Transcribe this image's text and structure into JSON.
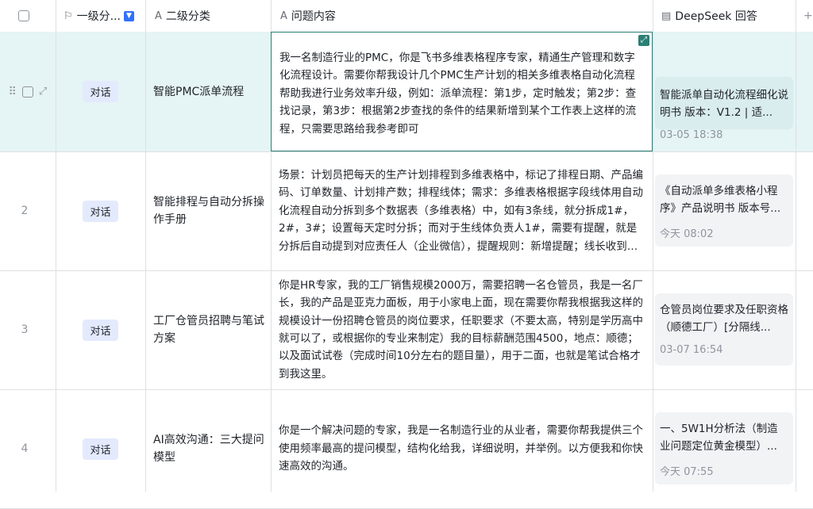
{
  "columns": {
    "level1": "一级分...",
    "level2": "二级分类",
    "question": "问题内容",
    "answer": "DeepSeek 回答"
  },
  "icons": {
    "level1": "flag-icon",
    "level2": "text-icon",
    "question": "text-icon",
    "answer": "document-icon",
    "filter": "filter-icon"
  },
  "rows": [
    {
      "index": "",
      "tag": "对话",
      "category": "智能PMC派单流程",
      "question": "我一名制造行业的PMC，你是飞书多维表格程序专家，精通生产管理和数字化流程设计。需要你帮我设计几个PMC生产计划的相关多维表格自动化流程帮助我进行业务效率升级，例如：派单流程：第1步，定时触发；第2步：查找记录，第3步：根据第2步查找的条件的结果新增到某个工作表上这样的流程，只需要思路给我参考即可",
      "answer_title": "智能派单自动化流程细化说明书 版本：V1.2 | 适...",
      "answer_date": "03-05 18:38"
    },
    {
      "index": "2",
      "tag": "对话",
      "category": "智能排程与自动分拆操作手册",
      "question": "场景：计划员把每天的生产计划排程到多维表格中，标记了排程日期、产品编码、订单数量、计划排产数；排程线体；需求：多维表格根据字段线体用自动化流程自动分拆到多个数据表（多维表格）中，如有3条线，就分拆成1#，2#，3#；设置每天定时分拆；而对于生线体负责人1#，需要有提醒，就是分拆后自动提到对应责任人（企业微信），提醒规则：新增提醒；线长收到派单后，需要有一...",
      "answer_title": "《自动派单多维表格小程序》产品说明书 版本号...",
      "answer_date": "今天 08:02"
    },
    {
      "index": "3",
      "tag": "对话",
      "category": "工厂仓管员招聘与笔试方案",
      "question": "你是HR专家，我的工厂销售规模2000万，需要招聘一名仓管员，我是一名厂长，我的产品是亚克力面板，用于小家电上面，现在需要你帮我根据我这样的规模设计一份招聘仓管员的岗位要求，任职要求（不要太高，特别是学历高中就可以了，或根据你的专业来制定）我的目标薪酬范围4500，地点：顺德；以及面试试卷（完成时间10分左右的题目量），用于二面，也就是笔试合格才到我这里。",
      "answer_title": "仓管员岗位要求及任职资格（顺德工厂）[分隔线...",
      "answer_date": "03-07 16:54"
    },
    {
      "index": "4",
      "tag": "对话",
      "category": "AI高效沟通：三大提问模型",
      "question": "你是一个解决问题的专家，我是一名制造行业的从业者，需要你帮我提供三个使用频率最高的提问模型，结构化给我，详细说明，并举例。以方便我和你快速高效的沟通。",
      "answer_title": "一、5W1H分析法（制造业问题定位黄金模型）...",
      "answer_date": "今天 07:55"
    }
  ]
}
